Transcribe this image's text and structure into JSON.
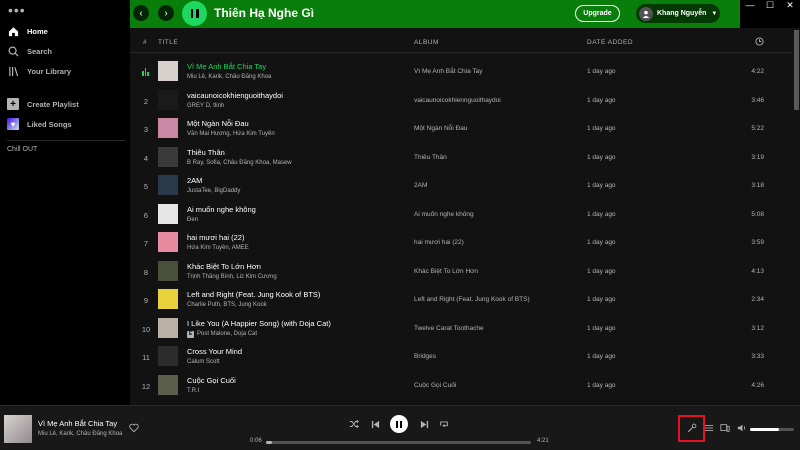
{
  "window": {
    "controls": [
      "—",
      "☐",
      "✕"
    ]
  },
  "sidebar": {
    "menu_dots": "•••",
    "nav": [
      {
        "label": "Home",
        "icon": "home-icon"
      },
      {
        "label": "Search",
        "icon": "search-icon"
      },
      {
        "label": "Your Library",
        "icon": "library-icon"
      }
    ],
    "create_playlist": "Create Playlist",
    "liked_songs": "Liked Songs",
    "playlists": [
      "Chill OUT"
    ]
  },
  "header": {
    "back": "‹",
    "forward": "›",
    "title": "Thiên Hạ Nghe Gì",
    "upgrade": "Upgrade",
    "user": "Khang Nguyễn",
    "accent_color": "#0a7e0a"
  },
  "table": {
    "headers": {
      "num": "#",
      "title": "TITLE",
      "album": "ALBUM",
      "date_added": "DATE ADDED",
      "duration_icon": "clock-icon"
    },
    "rows": [
      {
        "num": "1",
        "title": "Vì Mẹ Anh Bắt Chia Tay",
        "artist": "Miu Lê, Karik, Châu Đăng Khoa",
        "album": "Vì Mẹ Anh Bắt Chia Tay",
        "added": "1 day ago",
        "duration": "4:22",
        "playing": true,
        "thumb": "#d8d0cc"
      },
      {
        "num": "2",
        "title": "vaicaunoicokhienguoithaydoi",
        "artist": "GREY D, tlinh",
        "album": "vaicaunoicokhiennguoithaydoi",
        "added": "1 day ago",
        "duration": "3:46",
        "thumb": "#1a1a1a"
      },
      {
        "num": "3",
        "title": "Một Ngàn Nỗi Đau",
        "artist": "Văn Mai Hương, Hứa Kim Tuyền",
        "album": "Một Ngàn Nỗi Đau",
        "added": "1 day ago",
        "duration": "5:22",
        "thumb": "#c98aa6"
      },
      {
        "num": "4",
        "title": "Thiêu Thân",
        "artist": "B Ray, Sofia, Châu Đăng Khoa, Masew",
        "album": "Thiêu Thân",
        "added": "1 day ago",
        "duration": "3:19",
        "thumb": "#3a3a3a"
      },
      {
        "num": "5",
        "title": "2AM",
        "artist": "JustaTee, BigDaddy",
        "album": "2AM",
        "added": "1 day ago",
        "duration": "3:18",
        "thumb": "#2b3a4a"
      },
      {
        "num": "6",
        "title": "Ai muốn nghe không",
        "artist": "Đen",
        "album": "Ai muốn nghe không",
        "added": "1 day ago",
        "duration": "5:08",
        "thumb": "#e6e6e6"
      },
      {
        "num": "7",
        "title": "hai mươi hai (22)",
        "artist": "Hứa Kim Tuyền, AMEE",
        "album": "hai mươi hai (22)",
        "added": "1 day ago",
        "duration": "3:59",
        "thumb": "#e88aa0"
      },
      {
        "num": "8",
        "title": "Khác Biệt To Lớn Hơn",
        "artist": "Trịnh Thăng Bình, Liz Kim Cương",
        "album": "Khác Biệt To Lớn Hơn",
        "added": "1 day ago",
        "duration": "4:13",
        "thumb": "#4a4f3a"
      },
      {
        "num": "9",
        "title": "Left and Right (Feat. Jung Kook of BTS)",
        "artist": "Charlie Puth, BTS, Jung Kook",
        "album": "Left and Right (Feat. Jung Kook of BTS)",
        "added": "1 day ago",
        "duration": "2:34",
        "thumb": "#e7d23c"
      },
      {
        "num": "10",
        "title": "I Like You (A Happier Song) (with Doja Cat)",
        "artist": "Post Malone, Doja Cat",
        "album": "Twelve Carat Toothache",
        "added": "1 day ago",
        "duration": "3:12",
        "explicit": "E",
        "thumb": "#b9b1a4"
      },
      {
        "num": "11",
        "title": "Cross Your Mind",
        "artist": "Calum Scott",
        "album": "Bridges",
        "added": "1 day ago",
        "duration": "3:33",
        "thumb": "#2c2c2c"
      },
      {
        "num": "12",
        "title": "Cuộc Gọi Cuối",
        "artist": "T.R.I",
        "album": "Cuộc Gọi Cuối",
        "added": "1 day ago",
        "duration": "4:26",
        "thumb": "#5a5e4a"
      }
    ]
  },
  "player": {
    "title": "Vì Mẹ Anh Bắt Chia Tay",
    "artist": "Miu Lê, Karik, Châu Đăng Khoa",
    "elapsed": "0:06",
    "total": "4:21",
    "progress_fraction": 0.023,
    "volume_fraction": 0.65,
    "icons": {
      "like": "heart-icon",
      "shuffle": "shuffle-icon",
      "previous": "previous-icon",
      "play_pause": "pause-icon",
      "next": "next-icon",
      "repeat": "repeat-icon",
      "lyrics": "lyrics-microphone-icon",
      "queue": "queue-icon",
      "device": "connect-device-icon",
      "volume": "volume-icon"
    },
    "highlight_color": "#e81123"
  }
}
